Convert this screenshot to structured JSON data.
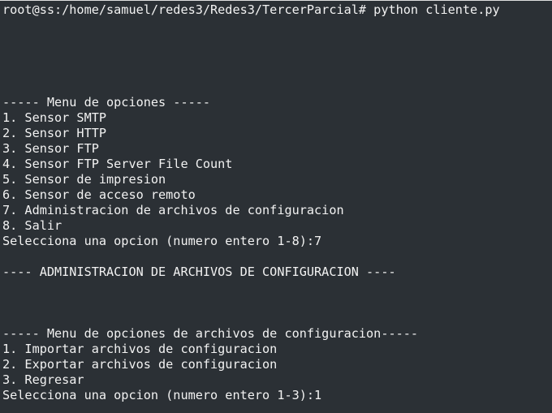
{
  "terminal": {
    "prompt": "root@ss:/home/samuel/redes3/Redes3/TercerParcial# python cliente.py",
    "menu_header": "----- Menu de opciones -----",
    "menu_items": [
      "1. Sensor SMTP",
      "2. Sensor HTTP",
      "3. Sensor FTP",
      "4. Sensor FTP Server File Count",
      "5. Sensor de impresion",
      "6. Sensor de acceso remoto",
      "7. Administracion de archivos de configuracion",
      "8. Salir"
    ],
    "menu_prompt": "Selecciona una opcion (numero entero 1-8):7",
    "section_title": "---- ADMINISTRACION DE ARCHIVOS DE CONFIGURACION ----",
    "submenu_header": "----- Menu de opciones de archivos de configuracion-----",
    "submenu_items": [
      "1. Importar archivos de configuracion",
      "2. Exportar archivos de configuracion",
      "3. Regresar"
    ],
    "submenu_prompt": "Selecciona una opcion (numero entero 1-3):1"
  },
  "colors": {
    "background": "#2b3035",
    "text": "#f2f2f2"
  }
}
